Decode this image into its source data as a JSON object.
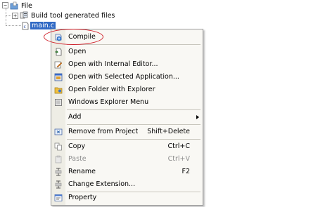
{
  "tree": {
    "root_label": "File",
    "child_label": "Build tool generated files",
    "selected_label": "main.c"
  },
  "menu": {
    "items": [
      {
        "label": "Compile",
        "shortcut": "",
        "icon": "compile-icon",
        "disabled": false
      },
      {
        "label": "Open",
        "shortcut": "",
        "icon": "open-icon",
        "disabled": false
      },
      {
        "label": "Open with Internal Editor...",
        "shortcut": "",
        "icon": "internal-editor-icon",
        "disabled": false
      },
      {
        "label": "Open with Selected Application...",
        "shortcut": "",
        "icon": "selected-application-icon",
        "disabled": false
      },
      {
        "label": "Open Folder with Explorer",
        "shortcut": "",
        "icon": "folder-explorer-icon",
        "disabled": false
      },
      {
        "label": "Windows Explorer Menu",
        "shortcut": "",
        "icon": "explorer-menu-icon",
        "disabled": false
      },
      {
        "label": "Add",
        "shortcut": "",
        "icon": "",
        "disabled": false,
        "submenu": true
      },
      {
        "label": "Remove from Project",
        "shortcut": "Shift+Delete",
        "icon": "remove-icon",
        "disabled": false
      },
      {
        "label": "Copy",
        "shortcut": "Ctrl+C",
        "icon": "copy-icon",
        "disabled": false
      },
      {
        "label": "Paste",
        "shortcut": "Ctrl+V",
        "icon": "paste-icon",
        "disabled": true
      },
      {
        "label": "Rename",
        "shortcut": "F2",
        "icon": "rename-icon",
        "disabled": false
      },
      {
        "label": "Change Extension...",
        "shortcut": "",
        "icon": "change-extension-icon",
        "disabled": false
      },
      {
        "label": "Property",
        "shortcut": "",
        "icon": "property-icon",
        "disabled": false
      }
    ]
  },
  "colors": {
    "selection": "#316ac5",
    "highlight_ellipse": "#d0202a",
    "menu_background": "#f9f8f4",
    "gutter": "#eeede5"
  }
}
